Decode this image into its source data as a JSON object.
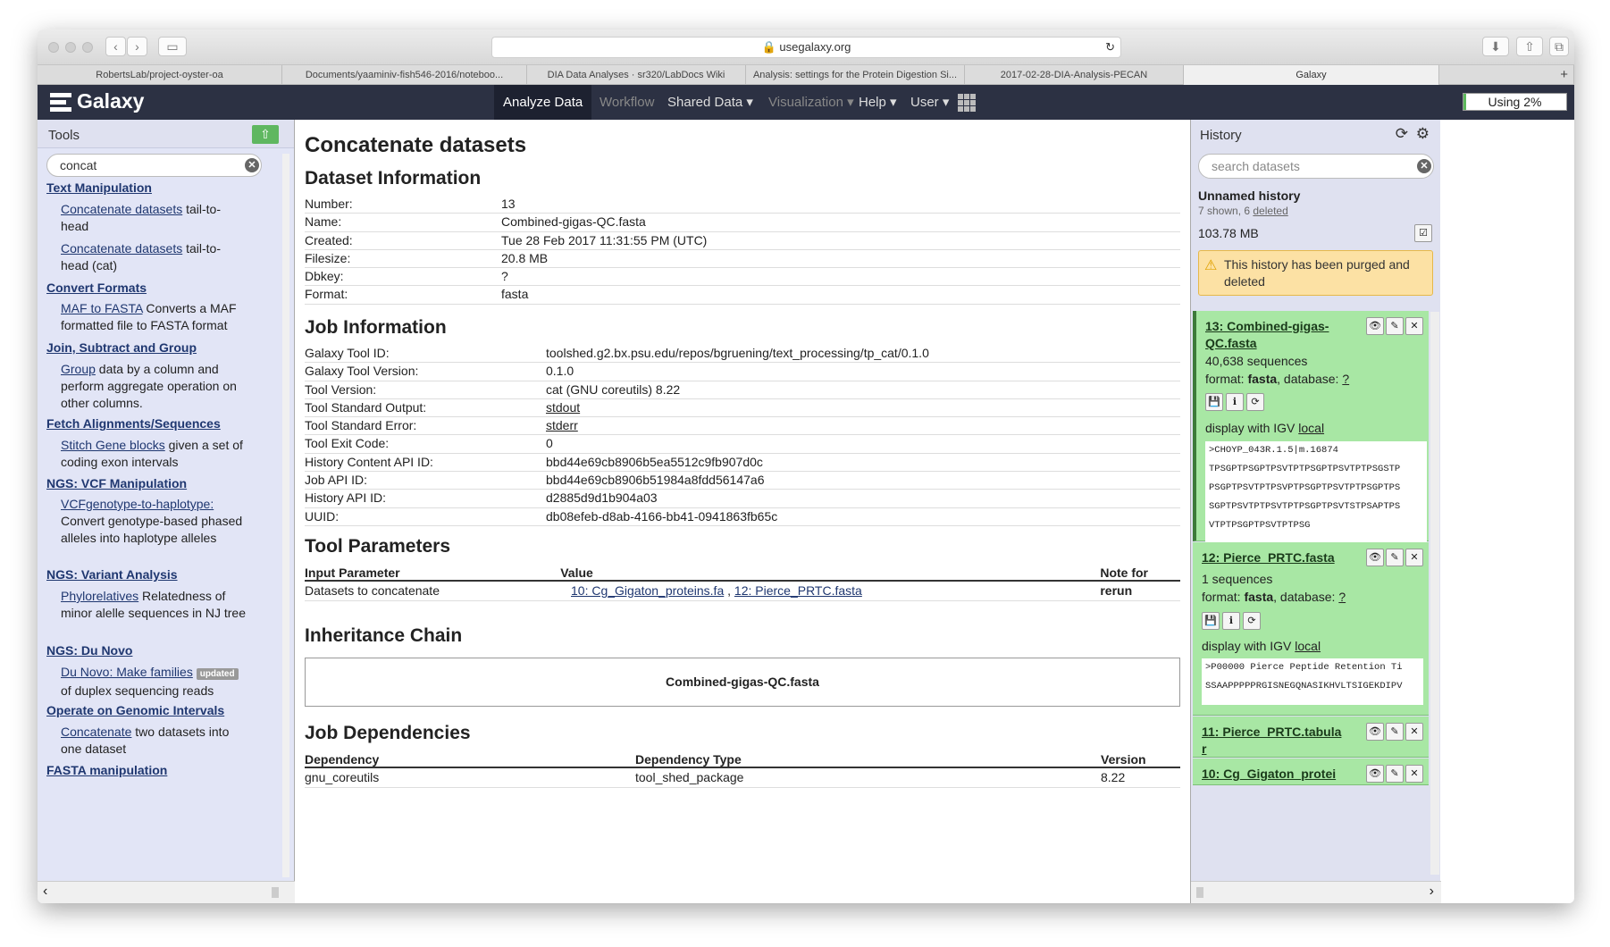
{
  "browser": {
    "url": "usegalaxy.org",
    "tabs": [
      "RobertsLab/project-oyster-oa",
      "Documents/yaaminiv-fish546-2016/noteboo...",
      "DIA Data Analyses · sr320/LabDocs Wiki",
      "Analysis: settings for the Protein Digestion Si...",
      "2017-02-28-DIA-Analysis-PECAN",
      "Galaxy"
    ]
  },
  "masthead": {
    "brand": "Galaxy",
    "nav": [
      "Analyze Data",
      "Workflow",
      "Shared Data ▾",
      "Visualization ▾",
      "Help ▾",
      "User ▾"
    ],
    "quota": "Using 2%"
  },
  "tools": {
    "title": "Tools",
    "search": "concat",
    "sections": [
      {
        "name": "Text Manipulation"
      },
      {
        "name": "Convert Formats"
      },
      {
        "name": "Join, Subtract and Group"
      },
      {
        "name": "Fetch Alignments/Sequences"
      },
      {
        "name": "NGS: VCF Manipulation"
      },
      {
        "name": "NGS: Variant Analysis"
      },
      {
        "name": "NGS: Du Novo"
      },
      {
        "name": "Operate on Genomic Intervals"
      },
      {
        "name": "FASTA manipulation"
      }
    ],
    "items": [
      {
        "link": "Concatenate datasets",
        "desc": " tail-to-head"
      },
      {
        "link": "Concatenate datasets",
        "desc": " tail-to-head (cat)"
      },
      {
        "link": "MAF to FASTA",
        "desc": " Converts a MAF formatted file to FASTA format"
      },
      {
        "link": "Group",
        "desc": " data by a column and perform aggregate operation on other columns."
      },
      {
        "link": "Stitch Gene blocks",
        "desc": " given a set of coding exon intervals"
      },
      {
        "link": "VCFgenotype-to-haplotype:",
        "desc": " Convert genotype-based phased alleles into haplotype alleles"
      },
      {
        "link": "Phylorelatives",
        "desc": " Relatedness of minor alelle sequences in NJ tree"
      },
      {
        "link": "Du Novo: Make families",
        "desc": " of duplex sequencing reads",
        "badge": "updated"
      },
      {
        "link": "Concatenate",
        "desc": " two datasets into one dataset"
      }
    ]
  },
  "center": {
    "title": "Concatenate datasets",
    "dataset_info_title": "Dataset Information",
    "dataset_info": [
      [
        "Number:",
        "13"
      ],
      [
        "Name:",
        "Combined-gigas-QC.fasta"
      ],
      [
        "Created:",
        "Tue 28 Feb 2017 11:31:55 PM (UTC)"
      ],
      [
        "Filesize:",
        "20.8 MB"
      ],
      [
        "Dbkey:",
        "?"
      ],
      [
        "Format:",
        "fasta"
      ]
    ],
    "job_info_title": "Job Information",
    "job_info": [
      [
        "Galaxy Tool ID:",
        "toolshed.g2.bx.psu.edu/repos/bgruening/text_processing/tp_cat/0.1.0"
      ],
      [
        "Galaxy Tool Version:",
        "0.1.0"
      ],
      [
        "Tool Version:",
        "cat (GNU coreutils) 8.22"
      ],
      [
        "Tool Standard Output:",
        "stdout"
      ],
      [
        "Tool Standard Error:",
        "stderr"
      ],
      [
        "Tool Exit Code:",
        "0"
      ],
      [
        "History Content API ID:",
        "bbd44e69cb8906b5ea5512c9fb907d0c"
      ],
      [
        "Job API ID:",
        "bbd44e69cb8906b51984a8fdd56147a6"
      ],
      [
        "History API ID:",
        "d2885d9d1b904a03"
      ],
      [
        "UUID:",
        "db08efeb-d8ab-4166-bb41-0941863fb65c"
      ]
    ],
    "params_title": "Tool Parameters",
    "params_headers": [
      "Input Parameter",
      "Value",
      "Note for rerun"
    ],
    "params_row": {
      "name": "Datasets to concatenate",
      "v1": "10: Cg_Gigaton_proteins.fa",
      "sep": " , ",
      "v2": "12: Pierce_PRTC.fasta"
    },
    "inherit_title": "Inheritance Chain",
    "inherit_value": "Combined-gigas-QC.fasta",
    "deps_title": "Job Dependencies",
    "deps_headers": [
      "Dependency",
      "Dependency Type",
      "Version"
    ],
    "deps_row": [
      "gnu_coreutils",
      "tool_shed_package",
      "8.22"
    ]
  },
  "history": {
    "title": "History",
    "search_placeholder": "search datasets",
    "name": "Unnamed history",
    "shown": "7 shown, 6 ",
    "deleted": "deleted",
    "size": "103.78 MB",
    "warning": "This history has been purged and deleted",
    "datasets": [
      {
        "title": "13: Combined-gigas-QC.fasta",
        "seqs": "40,638 sequences",
        "format": "fasta",
        "database": "?",
        "igv": "local",
        "peek": [
          ">CHOYP_043R.1.5|m.16874",
          "TPSGPTPSGPTPSVTPTPSGPTPSVTPTPSGSTP",
          "PSGPTPSVTPTPSVPTPSGPTPSVTPTPSGPTPS",
          "SGPTPSVTPTPSVTPTPSGPTPSVTSTPSAPTPS",
          "VTPTPSGPTPSVTPTPSG"
        ]
      },
      {
        "title": "12: Pierce_PRTC.fasta",
        "seqs": "1 sequences",
        "format": "fasta",
        "database": "?",
        "igv": "local",
        "peek": [
          ">P00000 Pierce Peptide Retention Ti",
          "SSAAPPPPPRGISNEGQNASIKHVLTSIGEKDIPV"
        ]
      },
      {
        "title": "11: Pierce_PRTC.tabular"
      },
      {
        "title": "10: Cg_Gigaton_protei"
      }
    ],
    "labels": {
      "format": "format: ",
      "database": ", database: ",
      "display": "display with IGV "
    }
  }
}
